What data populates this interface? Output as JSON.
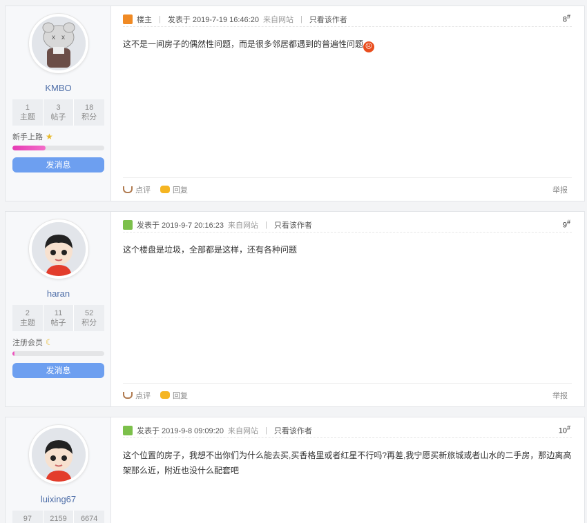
{
  "posts": [
    {
      "username": "KMBO",
      "avatar": "kaws-figure",
      "stats": [
        {
          "value": "1",
          "label": "主题"
        },
        {
          "value": "3",
          "label": "帖子"
        },
        {
          "value": "18",
          "label": "积分"
        }
      ],
      "rank": "新手上路",
      "rank_icon": "star-icon",
      "progress": 0.36,
      "message_btn": "发消息",
      "owner_label": "楼主",
      "posted": "发表于 2019-7-19 16:46:20",
      "source": "来自网站",
      "only_author": "只看该作者",
      "floor": "8",
      "content": "这不是一间房子的偶然性问题，而是很多邻居都遇到的普遍性问题",
      "review": "点评",
      "reply": "回复",
      "report": "举报"
    },
    {
      "username": "haran",
      "avatar": "cartoon-avatar",
      "stats": [
        {
          "value": "2",
          "label": "主题"
        },
        {
          "value": "11",
          "label": "帖子"
        },
        {
          "value": "52",
          "label": "积分"
        }
      ],
      "rank": "注册会员",
      "rank_icon": "moon-icon",
      "progress": 0.02,
      "message_btn": "发消息",
      "posted": "发表于 2019-9-7 20:16:23",
      "source": "来自网站",
      "only_author": "只看该作者",
      "floor": "9",
      "content": "这个楼盘是垃圾，全部都是这样，还有各种问题",
      "review": "点评",
      "reply": "回复",
      "report": "举报"
    },
    {
      "username": "luixing67",
      "avatar": "cartoon-avatar",
      "stats": [
        {
          "value": "97",
          "label": ""
        },
        {
          "value": "2159",
          "label": ""
        },
        {
          "value": "6674",
          "label": ""
        }
      ],
      "posted": "发表于 2019-9-8 09:09:20",
      "source": "来自网站",
      "only_author": "只看该作者",
      "floor": "10",
      "content": "这个位置的房子，我想不出你们为什么能去买,买香格里或者红星不行吗?再差,我宁愿买新旅城或者山水的二手房，那边离高架那么近，附近也没什么配套吧"
    }
  ],
  "colors": {
    "accent": "#6d9ff0",
    "username": "#4e6ea8",
    "owner_badge": "#f08a24",
    "post_badge": "#7cc04b"
  }
}
